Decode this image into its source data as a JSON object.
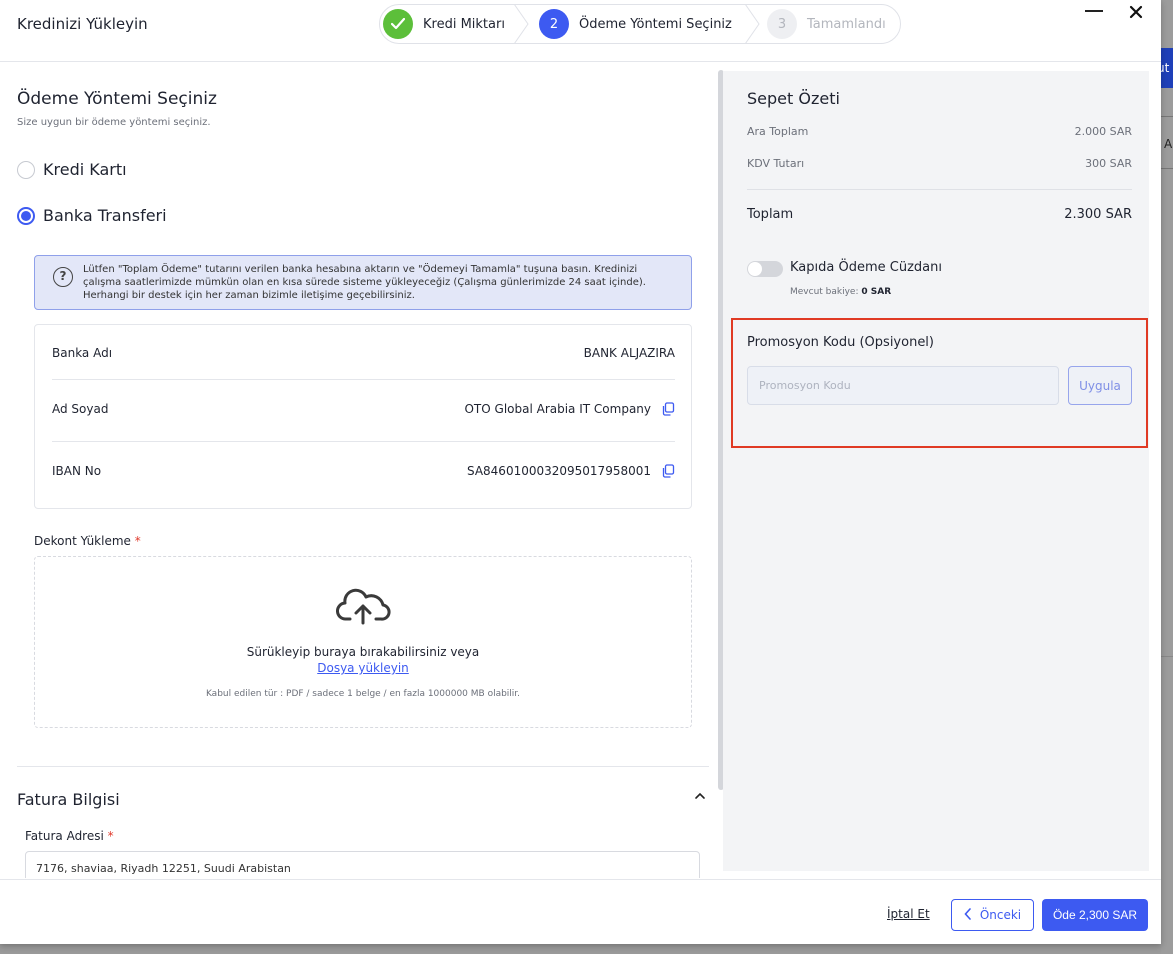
{
  "modal": {
    "title": "Kredinizi Yükleyin"
  },
  "stepper": {
    "steps": [
      {
        "number": "",
        "label": "Kredi Miktarı"
      },
      {
        "number": "2",
        "label": "Ödeme Yöntemi Seçiniz"
      },
      {
        "number": "3",
        "label": "Tamamlandı"
      }
    ]
  },
  "payment": {
    "title": "Ödeme Yöntemi Seçiniz",
    "subtitle": "Size uygun bir ödeme yöntemi seçiniz.",
    "options": [
      {
        "label": "Kredi Kartı",
        "selected": false
      },
      {
        "label": "Banka Transferi",
        "selected": true
      }
    ],
    "info_text": "Lütfen \"Toplam Ödeme\" tutarını verilen banka hesabına aktarın ve \"Ödemeyi Tamamla\" tuşuna basın. Kredinizi çalışma saatlerimizde mümkün olan en kısa sürede sisteme yükleyeceğiz (Çalışma günlerimizde 24 saat içinde). Herhangi bir destek için her zaman bizimle iletişime geçebilirsiniz."
  },
  "bank": {
    "rows": [
      {
        "key": "Banka Adı",
        "value": "BANK ALJAZIRA"
      },
      {
        "key": "Ad Soyad",
        "value": "OTO Global Arabia IT Company"
      },
      {
        "key": "IBAN No",
        "value": "SA8460100032095017958001"
      }
    ]
  },
  "upload": {
    "label": "Dekont Yükleme",
    "required_mark": "*",
    "drag_text": "Sürükleyip buraya bırakabilirsiniz veya",
    "link_text": "Dosya yükleyin",
    "hint": "Kabul edilen tür : PDF / sadece 1 belge / en fazla 1000000 MB olabilir."
  },
  "invoice": {
    "title": "Fatura Bilgisi",
    "address_label": "Fatura Adresi",
    "required_mark": "*",
    "address_value": "7176, shaviaa, Riyadh 12251, Suudi Arabistan"
  },
  "summary": {
    "title": "Sepet Özeti",
    "subtotal_label": "Ara Toplam",
    "subtotal_value": "2.000 SAR",
    "vat_label": "KDV Tutarı",
    "vat_value": "300 SAR",
    "total_label": "Toplam",
    "total_value": "2.300 SAR",
    "wallet_label": "Kapıda Ödeme Cüzdanı",
    "balance_label": "Mevcut bakiye:",
    "balance_value": "0 SAR",
    "promo_title": "Promosyon Kodu (Opsiyonel)",
    "promo_placeholder": "Promosyon Kodu",
    "promo_button": "Uygula"
  },
  "footer": {
    "cancel": "İptal Et",
    "previous": "Önceki",
    "pay": "Öde 2,300 SAR"
  },
  "background": {
    "button_fragment": "ut",
    "letter": "A"
  },
  "colors": {
    "primary": "#3d5af1",
    "success": "#5cbf3a",
    "highlight": "#e03a24",
    "required": "#e0392b"
  },
  "icons": [
    "check-icon",
    "question-icon",
    "copy-icon",
    "cloud-upload-icon",
    "chevron-up-icon",
    "chevron-left-icon",
    "close-icon",
    "minimize-icon"
  ]
}
